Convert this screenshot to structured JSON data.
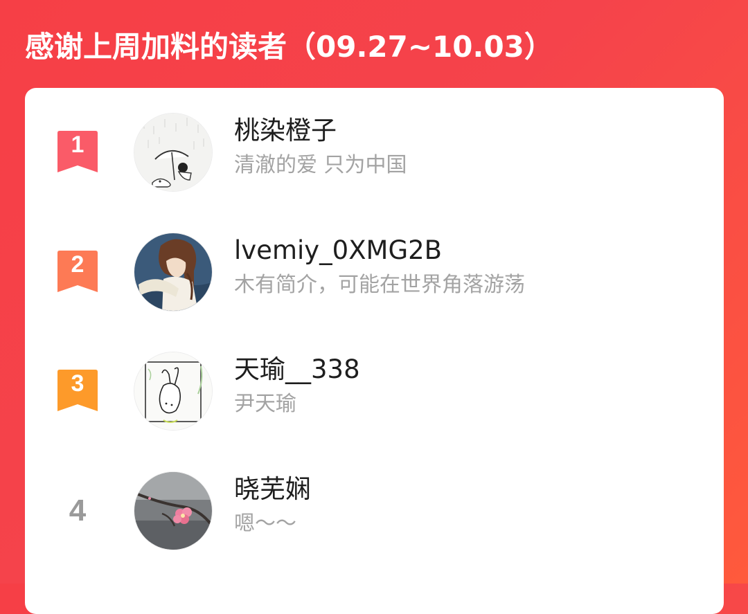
{
  "header": {
    "title": "感谢上周加料的读者（09.27~10.03）"
  },
  "colors": {
    "background_start": "#f63f46",
    "background_end": "#ff5a3c",
    "rank_1": "#fa5b68",
    "rank_2": "#fd7a55",
    "rank_3": "#fd9a2a",
    "rank_plain": "#9a9a9a",
    "name_text": "#1e1e1e",
    "bio_text": "#a3a3a3"
  },
  "readers": [
    {
      "rank": "1",
      "name": "桃染橙子",
      "bio": "清澈的爱 只为中国",
      "avatar_icon": "umbrella-sketch-avatar"
    },
    {
      "rank": "2",
      "name": "lvemiy_0XMG2B",
      "bio": "木有简介，可能在世界角落游荡",
      "avatar_icon": "anime-girl-avatar"
    },
    {
      "rank": "3",
      "name": "天瑜__338",
      "bio": "尹天瑜",
      "avatar_icon": "rabbit-sketch-avatar"
    },
    {
      "rank": "4",
      "name": "晓芜娴",
      "bio": "嗯～～",
      "avatar_icon": "plum-blossom-avatar"
    }
  ]
}
